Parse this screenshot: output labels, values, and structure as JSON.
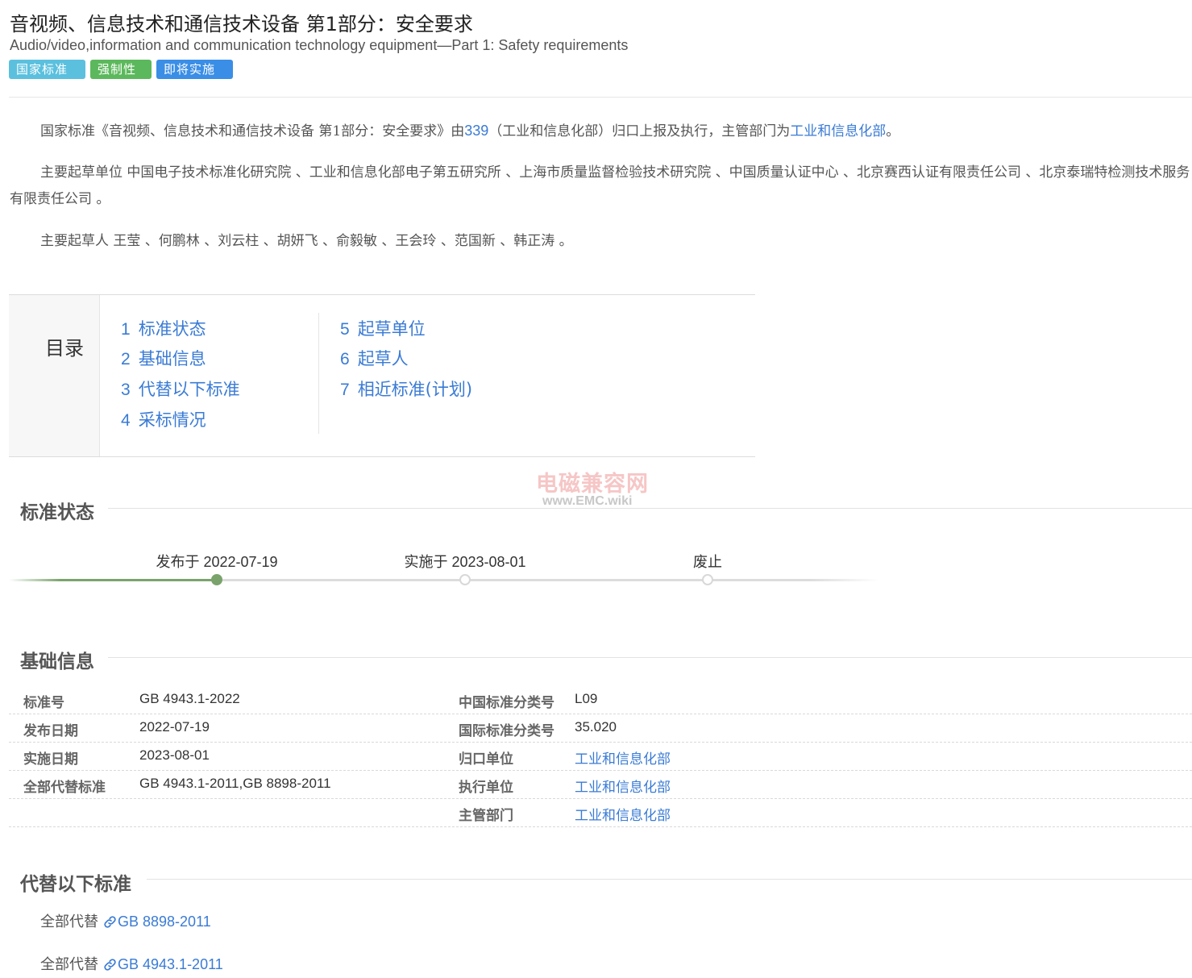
{
  "header": {
    "title_cn": "音视频、信息技术和通信技术设备 第1部分：安全要求",
    "title_en": "Audio/video,information and communication technology equipment—Part 1: Safety requirements",
    "tags": [
      {
        "label": "国家标准",
        "color": "#5bc0de"
      },
      {
        "label": "强制性",
        "color": "#5cb85c"
      },
      {
        "label": "即将实施",
        "color": "#3a8ee6"
      }
    ]
  },
  "intro": {
    "p1_a": "国家标准《音视频、信息技术和通信技术设备 第1部分：安全要求》由",
    "p1_code": "339",
    "p1_b": "（工业和信息化部）归口上报及执行，主管部门为",
    "p1_dept": "工业和信息化部",
    "p1_end": "。",
    "p2": "主要起草单位 中国电子技术标准化研究院 、工业和信息化部电子第五研究所 、上海市质量监督检验技术研究院 、中国质量认证中心 、北京赛西认证有限责任公司 、北京泰瑞特检测技术服务有限责任公司 。",
    "p3": "主要起草人 王莹 、何鹏林 、刘云柱 、胡妍飞 、俞毅敏 、王会玲 、范国新 、韩正涛 。"
  },
  "toc": {
    "title": "目录",
    "items": [
      {
        "num": "1",
        "label": "标准状态"
      },
      {
        "num": "2",
        "label": "基础信息"
      },
      {
        "num": "3",
        "label": "代替以下标准"
      },
      {
        "num": "4",
        "label": "采标情况"
      },
      {
        "num": "5",
        "label": "起草单位"
      },
      {
        "num": "6",
        "label": "起草人"
      },
      {
        "num": "7",
        "label": "相近标准(计划)"
      }
    ]
  },
  "watermark": {
    "cn": "电磁兼容网",
    "en": "www.EMC.wiki"
  },
  "status": {
    "title": "标准状态",
    "steps": [
      {
        "label": "发布于 2022-07-19",
        "done": true
      },
      {
        "label": "实施于 2023-08-01",
        "done": false
      },
      {
        "label": "废止",
        "done": false
      }
    ],
    "accent": "#7aa36c"
  },
  "basic": {
    "title": "基础信息",
    "rows": [
      {
        "l_label": "标准号",
        "l_value": "GB 4943.1-2022",
        "r_label": "中国标准分类号",
        "r_value": "L09"
      },
      {
        "l_label": "发布日期",
        "l_value": "2022-07-19",
        "r_label": "国际标准分类号",
        "r_value": "35.020"
      },
      {
        "l_label": "实施日期",
        "l_value": "2023-08-01",
        "r_label": "归口单位",
        "r_value": "工业和信息化部"
      },
      {
        "l_label": "全部代替标准",
        "l_value": "GB 4943.1-2011,GB 8898-2011",
        "r_label": "执行单位",
        "r_value": "工业和信息化部"
      },
      {
        "l_label": "",
        "l_value": "",
        "r_label": "主管部门",
        "r_value": "工业和信息化部"
      }
    ]
  },
  "replace": {
    "title": "代替以下标准",
    "items": [
      {
        "prefix": "全部代替",
        "code": "GB 8898-2011"
      },
      {
        "prefix": "全部代替",
        "code": "GB 4943.1-2011"
      }
    ]
  }
}
